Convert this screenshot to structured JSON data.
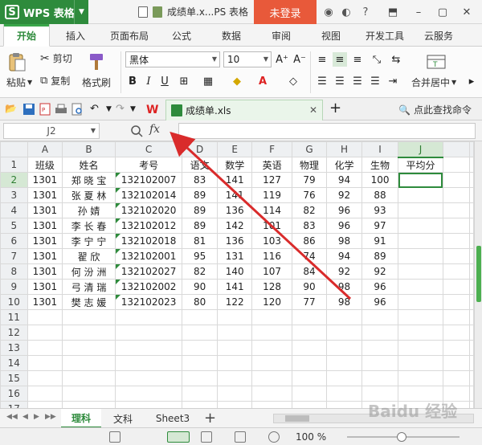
{
  "titlebar": {
    "app_name": "WPS 表格",
    "doc_title": "成绩单.x...PS 表格",
    "login_label": "未登录"
  },
  "ribbon_tabs": [
    {
      "label": "开始",
      "active": true
    },
    {
      "label": "插入"
    },
    {
      "label": "页面布局"
    },
    {
      "label": "公式"
    },
    {
      "label": "数据"
    },
    {
      "label": "审阅"
    },
    {
      "label": "视图"
    },
    {
      "label": "开发工具"
    },
    {
      "label": "云服务"
    }
  ],
  "ribbon": {
    "cut_label": "剪切",
    "paste_label": "粘贴",
    "copy_label": "复制",
    "format_painter_label": "格式刷",
    "font_name": "黑体",
    "font_size": "10",
    "merge_label": "合并居中"
  },
  "qabar": {
    "doc_tab_label": "成绩单.xls",
    "find_cmd_label": "点此查找命令"
  },
  "formula_bar": {
    "name_box": "J2",
    "fx_label": "fx"
  },
  "grid": {
    "columns": [
      "A",
      "B",
      "C",
      "D",
      "E",
      "F",
      "G",
      "H",
      "I",
      "J"
    ],
    "selected_column": "J",
    "selected_row": 2,
    "header_row": [
      "班级",
      "姓名",
      "考号",
      "语文",
      "数学",
      "英语",
      "物理",
      "化学",
      "生物",
      "平均分"
    ],
    "rows": [
      [
        "1301",
        "郑 晓 宝",
        "132102007",
        "83",
        "141",
        "127",
        "79",
        "94",
        "100",
        ""
      ],
      [
        "1301",
        "张 夏 林",
        "132102014",
        "89",
        "141",
        "119",
        "76",
        "92",
        "88",
        ""
      ],
      [
        "1301",
        "孙       婧",
        "132102020",
        "89",
        "136",
        "114",
        "82",
        "96",
        "93",
        ""
      ],
      [
        "1301",
        "李 长 春",
        "132102012",
        "89",
        "142",
        "101",
        "83",
        "96",
        "97",
        ""
      ],
      [
        "1301",
        "李 宁 宁",
        "132102018",
        "81",
        "136",
        "103",
        "86",
        "98",
        "91",
        ""
      ],
      [
        "1301",
        "翟       欣",
        "132102001",
        "95",
        "131",
        "116",
        "74",
        "94",
        "89",
        ""
      ],
      [
        "1301",
        "何 汾 洲",
        "132102027",
        "82",
        "140",
        "107",
        "84",
        "92",
        "92",
        ""
      ],
      [
        "1301",
        "弓 清 瑞",
        "132102002",
        "90",
        "141",
        "128",
        "90",
        "98",
        "96",
        ""
      ],
      [
        "1301",
        "樊 志 媛",
        "132102023",
        "80",
        "122",
        "120",
        "77",
        "98",
        "96",
        ""
      ]
    ],
    "total_rows": 17
  },
  "sheets": [
    {
      "label": "理科",
      "active": true
    },
    {
      "label": "文科"
    },
    {
      "label": "Sheet3"
    }
  ],
  "statusbar": {
    "zoom_label": "100 %"
  },
  "watermark": "Baidu 经验",
  "colors": {
    "brand_green": "#2e8b3c",
    "login_orange": "#e8593a",
    "arrow_red": "#d92b2b"
  }
}
